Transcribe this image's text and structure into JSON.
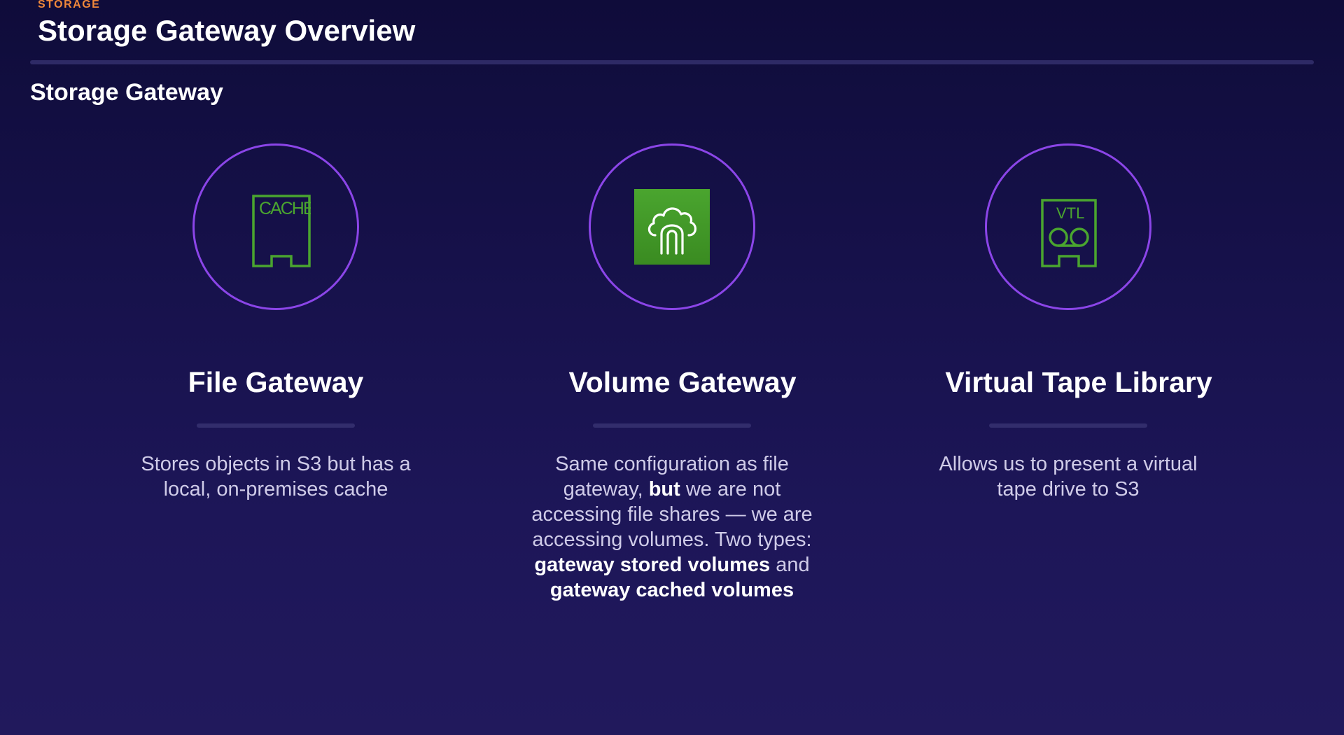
{
  "header": {
    "kicker": "STORAGE",
    "title": "Storage Gateway Overview"
  },
  "section": {
    "title": "Storage Gateway"
  },
  "colors": {
    "accent_orange": "#f0883a",
    "ring_purple": "#8b45e8",
    "icon_green": "#4aa52f"
  },
  "cards": [
    {
      "icon": "file-gateway-cache-icon",
      "icon_text": "CACHE",
      "title": "File Gateway",
      "description": "Stores objects in S3 but has a local, on-premises cache"
    },
    {
      "icon": "volume-gateway-icon",
      "title": "Volume Gateway",
      "desc_parts": [
        "Same configuration as file gateway, ",
        "but",
        " we are not accessing file shares — we are accessing volumes. Two types: ",
        "gateway stored volumes",
        " and ",
        "gateway cached volumes"
      ]
    },
    {
      "icon": "virtual-tape-library-icon",
      "icon_text": "VTL",
      "title": "Virtual Tape Library",
      "description": "Allows us to present a virtual tape drive to S3"
    }
  ]
}
